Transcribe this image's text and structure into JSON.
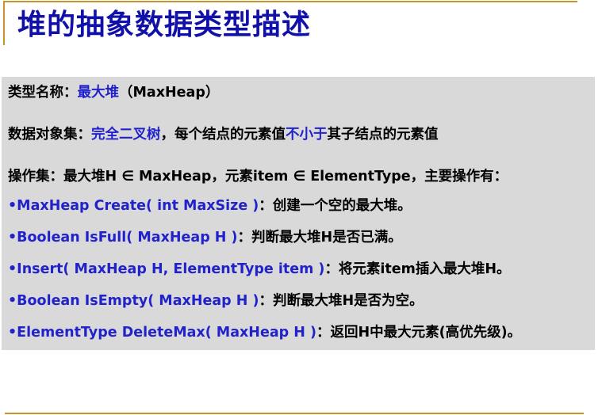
{
  "title": "堆的抽象数据类型描述",
  "type_name": {
    "label": "类型名称：",
    "value": "最大堆",
    "suffix": "（MaxHeap）"
  },
  "data_set": {
    "label": "数据对象集：",
    "value1": "完全二叉树",
    "mid": "，每个结点的元素值",
    "value2": "不小于",
    "tail": "其子结点的元素值"
  },
  "operation_set": {
    "text": "操作集：最大堆H ∈ MaxHeap，元素item ∈ ElementType，主要操作有："
  },
  "operations": [
    {
      "sig": "•MaxHeap Create( int MaxSize )",
      "desc": "：创建一个空的最大堆。"
    },
    {
      "sig": "•Boolean IsFull( MaxHeap H )",
      "desc": "：判断最大堆H是否已满。"
    },
    {
      "sig": "•Insert( MaxHeap H, ElementType item )",
      "desc": "：将元素item插入最大堆H。"
    },
    {
      "sig": "•Boolean IsEmpty( MaxHeap H )",
      "desc": "：判断最大堆H是否为空。"
    },
    {
      "sig": "•ElementType DeleteMax( MaxHeap H )",
      "desc": "：返回H中最大元素(高优先级)。"
    }
  ],
  "colors": {
    "accent_rule": "#c8952c",
    "title_blue": "#1111aa",
    "term_blue": "#2222cc",
    "panel_gray": "#d9d9d9"
  }
}
